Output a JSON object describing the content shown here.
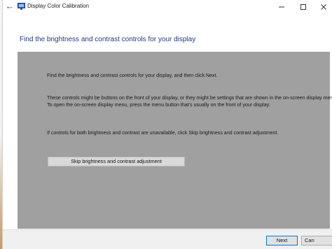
{
  "window": {
    "title": "Display Color Calibration"
  },
  "page": {
    "heading": "Find the brightness and contrast controls for your display",
    "paragraphs": [
      "Find the brightness and contrast controls for your display, and then click Next.",
      "These controls might be buttons on the front of your display, or they might be settings that are shown in the on-screen display menu. To open the on-screen display menu, press the menu button that's usually on the front of your display.",
      "If controls for both brightness and contrast are unavailable, click Skip brightness and contrast adjustment."
    ],
    "skip_button_label": "Skip brightness and contrast adjustment"
  },
  "footer": {
    "next_label": "Next",
    "cancel_label": "Can"
  },
  "colors": {
    "heading": "#1e3a84",
    "panel": "#a0a0a0",
    "focus_border": "#0078d7"
  },
  "icons": {
    "back": "back-arrow-icon",
    "app": "display-icon",
    "minimize": "minimize-icon",
    "maximize": "maximize-icon",
    "close": "close-icon"
  }
}
